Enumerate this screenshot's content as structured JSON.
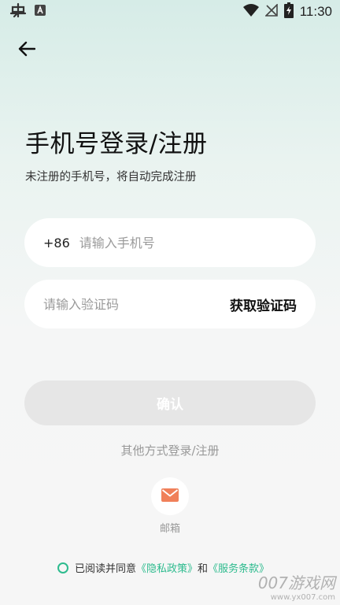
{
  "status_bar": {
    "time": "11:30",
    "icons": [
      "bug-icon",
      "a-notification-icon",
      "wifi-icon",
      "no-signal-icon",
      "battery-charging-icon"
    ]
  },
  "header": {
    "back_icon": "arrow-left-icon"
  },
  "main": {
    "title": "手机号登录/注册",
    "subtitle": "未注册的手机号，将自动完成注册",
    "phone": {
      "prefix": "+86",
      "placeholder": "请输入手机号",
      "value": ""
    },
    "code": {
      "placeholder": "请输入验证码",
      "value": "",
      "get_code_label": "获取验证码"
    },
    "confirm_label": "确认",
    "other_login_label": "其他方式登录/注册",
    "mail_option": {
      "icon": "mail-icon",
      "label": "邮箱"
    }
  },
  "agreement": {
    "prefix": "已阅读并同意",
    "privacy_link": "《隐私政策》",
    "and": "和",
    "terms_link": "《服务条款》"
  },
  "watermark": {
    "main": "007游戏网",
    "url": "www.yx007.com"
  },
  "colors": {
    "accent": "#2dbb8e",
    "mail": "#f0805a",
    "button_disabled": "#e6e6e6"
  }
}
